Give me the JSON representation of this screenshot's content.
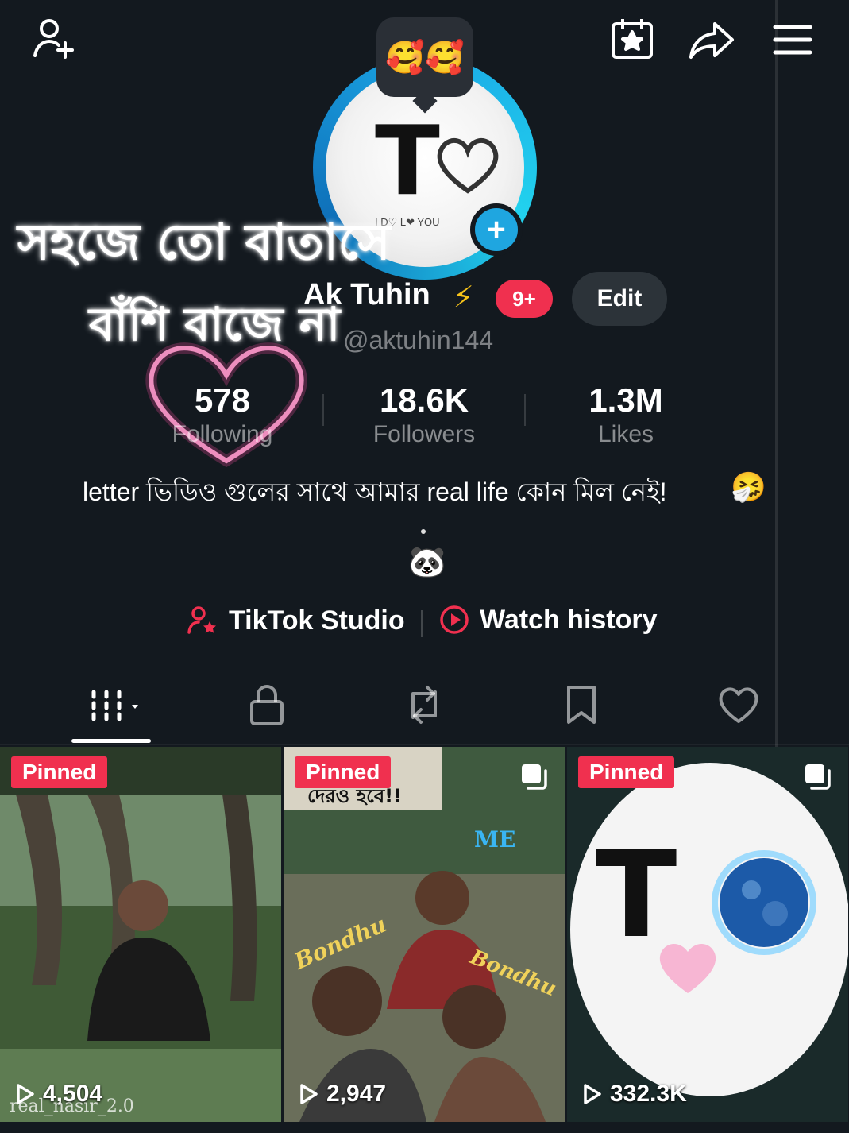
{
  "header": {
    "icons": [
      "add-friend-icon",
      "calendar-star-icon",
      "share-icon",
      "menu-icon"
    ]
  },
  "avatar": {
    "letter": "T",
    "tag_text": "I D♡ L❤ YOU",
    "bubble_emoji": "🥰🥰",
    "plus_label": "+"
  },
  "overlay_text": {
    "line1": "সহজে তো বাতাসে",
    "line2": "বাঁশি বাজে না"
  },
  "profile": {
    "name": "Ak Tuhin",
    "badge_emoji": "⚡",
    "notification_count": "9+",
    "edit_label": "Edit",
    "handle": "@aktuhin144"
  },
  "stats": {
    "following": {
      "value": "578",
      "label": "Following"
    },
    "followers": {
      "value": "18.6K",
      "label": "Followers"
    },
    "likes": {
      "value": "1.3M",
      "label": "Likes"
    }
  },
  "bio": {
    "text": "letter ভিডিও গুলের সাথে আমার real life কোন মিল নেই!",
    "emoji": "🤧",
    "panda": "🐼"
  },
  "links": {
    "studio": "TikTok Studio",
    "history": "Watch history"
  },
  "tabs": [
    "videos-grid-icon",
    "lock-icon",
    "repost-icon",
    "bookmark-icon",
    "heart-icon"
  ],
  "videos": [
    {
      "pinned": "Pinned",
      "views": "4,504"
    },
    {
      "pinned": "Pinned",
      "views": "2,947",
      "caption_top": "দেরও হবে!!",
      "caption_me": "ME",
      "caption_bondhu1": "Bondhu",
      "caption_bondhu2": "Bondhu"
    },
    {
      "pinned": "Pinned",
      "views": "332.3K",
      "letter": "T"
    }
  ],
  "watermark": "real_nasir_2.0",
  "colors": {
    "background": "#13191f",
    "accent_red": "#f0304f",
    "ring_blue": "#1aa7e6"
  }
}
